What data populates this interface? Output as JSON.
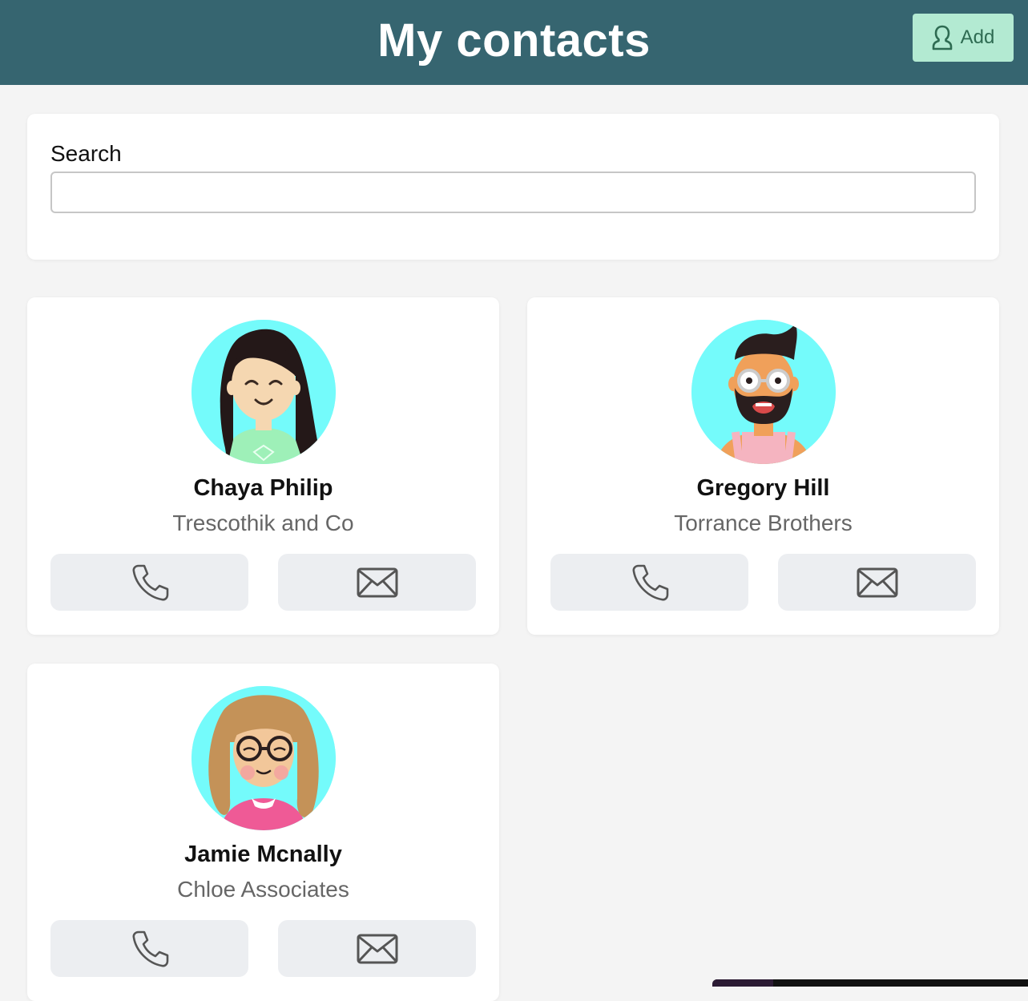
{
  "header": {
    "title": "My contacts",
    "add_label": "Add"
  },
  "search": {
    "label": "Search",
    "value": "",
    "placeholder": ""
  },
  "contacts": [
    {
      "name": "Chaya Philip",
      "company": "Trescothik and Co",
      "avatar": "avatar-woman-dark-hair"
    },
    {
      "name": "Gregory Hill",
      "company": "Torrance Brothers",
      "avatar": "avatar-man-beard-glasses"
    },
    {
      "name": "Jamie Mcnally",
      "company": "Chloe Associates",
      "avatar": "avatar-woman-curly-hair-glasses"
    }
  ],
  "icons": {
    "add": "user-icon",
    "phone": "phone-icon",
    "email": "envelope-icon"
  },
  "colors": {
    "header": "#366570",
    "add_button": "#b3ead2",
    "avatar_bg": "#74fbfb",
    "action_button": "#eceef1"
  }
}
